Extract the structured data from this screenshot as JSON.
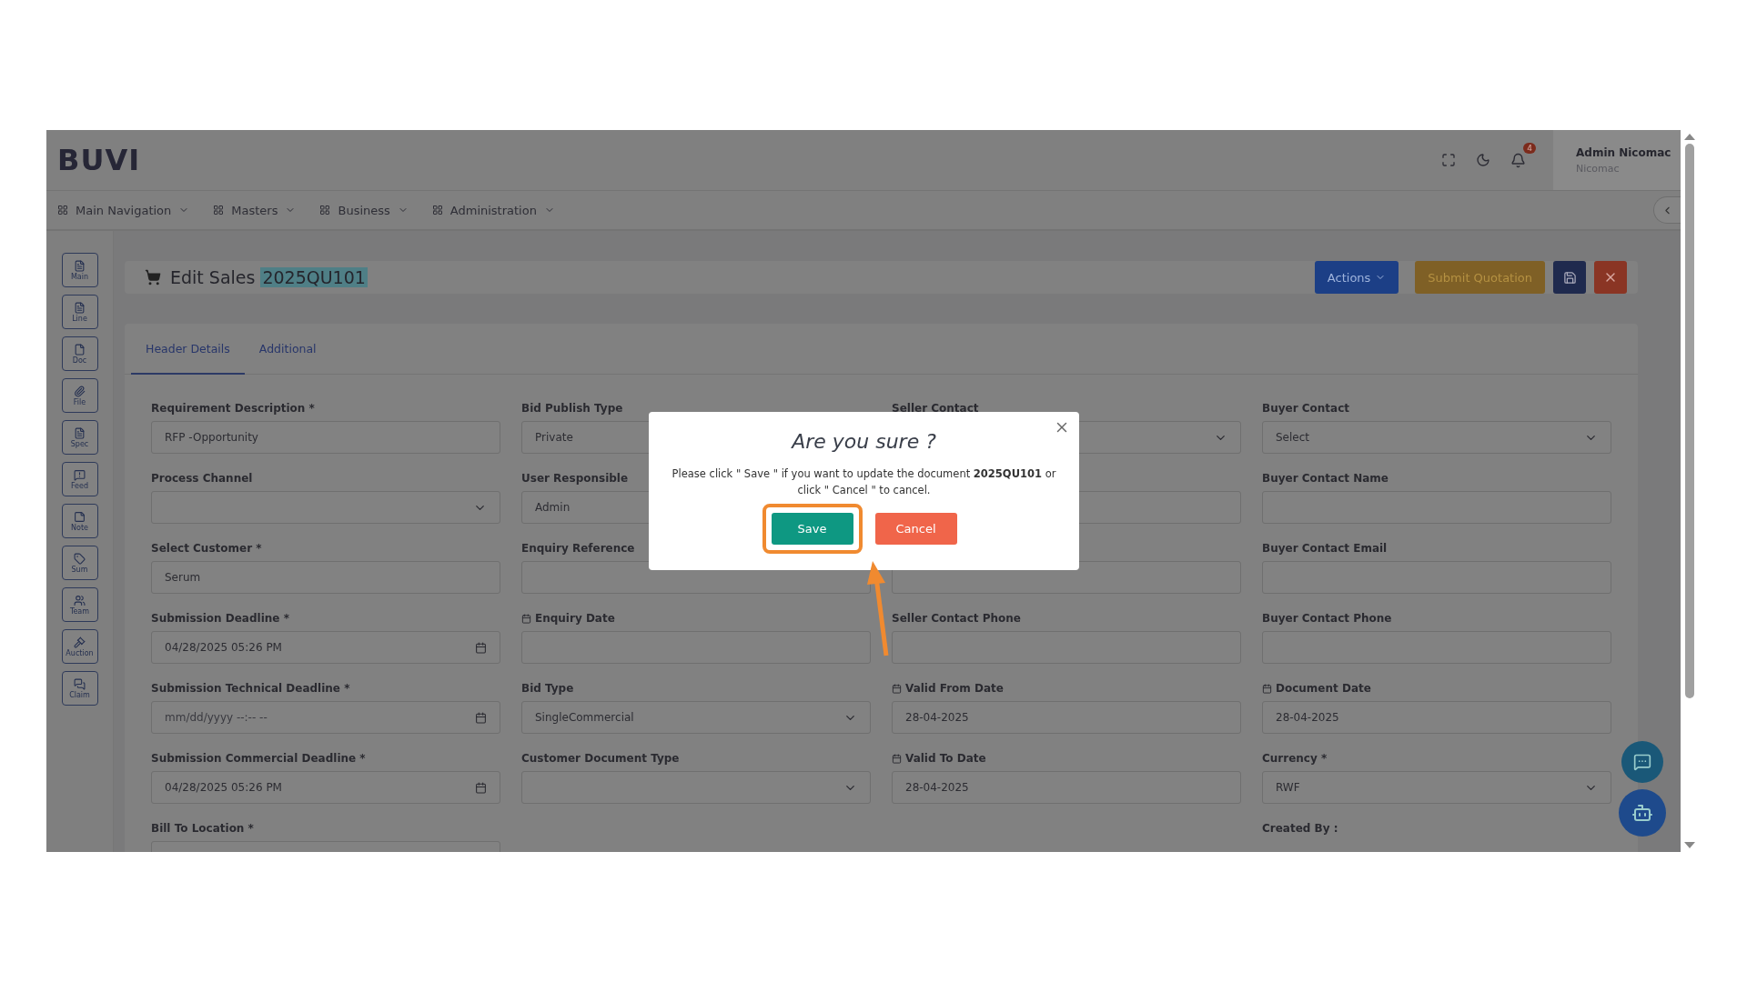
{
  "brand": "BUVI",
  "toolbar": {
    "notification_count": "4",
    "user_name": "Admin Nicomac",
    "user_org": "Nicomac"
  },
  "nav": [
    {
      "label": "Main Navigation"
    },
    {
      "label": "Masters"
    },
    {
      "label": "Business"
    },
    {
      "label": "Administration"
    }
  ],
  "side_tools": [
    {
      "label": "Main",
      "kind": "doc"
    },
    {
      "label": "Line",
      "kind": "doc"
    },
    {
      "label": "Doc",
      "kind": "page"
    },
    {
      "label": "File",
      "kind": "clip"
    },
    {
      "label": "Spec",
      "kind": "doc"
    },
    {
      "label": "Feed",
      "kind": "feedback"
    },
    {
      "label": "Note",
      "kind": "note"
    },
    {
      "label": "Sum",
      "kind": "tag"
    },
    {
      "label": "Team",
      "kind": "team"
    },
    {
      "label": "Auction",
      "kind": "gavel"
    },
    {
      "label": "Claim",
      "kind": "chat"
    }
  ],
  "page": {
    "title": "Edit Sales",
    "doc_no": "2025QU101",
    "doc_no_highlighted": true
  },
  "actions": [
    {
      "kind": "dropdown",
      "label": "Actions"
    },
    {
      "kind": "text",
      "label": "Submit Quotation"
    },
    {
      "kind": "save"
    },
    {
      "kind": "close"
    }
  ],
  "tabs": [
    {
      "label": "Header Details",
      "selected": true
    },
    {
      "label": "Additional",
      "selected": false
    }
  ],
  "columns": [
    [
      {
        "label": "Requirement Description *",
        "kind": "text",
        "value": "RFP -Opportunity"
      },
      {
        "label": "Process Channel",
        "kind": "select"
      },
      {
        "label": "Select Customer *",
        "kind": "text",
        "value": "Serum"
      },
      {
        "label": "Submission Deadline *",
        "kind": "datetime",
        "value": "04/28/2025 05:26 PM"
      },
      {
        "label": "Submission Technical Deadline *",
        "kind": "datetime",
        "placeholder": "mm/dd/yyyy --:-- --"
      },
      {
        "label": "Submission Commercial Deadline *",
        "kind": "datetime",
        "value": "04/28/2025 05:26 PM"
      },
      {
        "label": "Bill To Location *",
        "kind": "text"
      }
    ],
    [
      {
        "label": "Bid Publish Type",
        "kind": "text",
        "value": "Private"
      },
      {
        "label": "User Responsible",
        "kind": "text",
        "value": "Admin"
      },
      {
        "label": "Enquiry Reference",
        "kind": "text"
      },
      {
        "label": "Enquiry Date",
        "kind": "date"
      },
      {
        "label": "Bid Type",
        "kind": "select",
        "value": "SingleCommercial"
      },
      {
        "label": "Customer Document Type",
        "kind": "select"
      }
    ],
    [
      {
        "label": "Seller Contact",
        "kind": "select"
      },
      {
        "kind": "text"
      },
      {
        "kind": "text"
      },
      {
        "label": "Seller Contact Phone",
        "kind": "text"
      },
      {
        "label": "Valid From Date",
        "kind": "date",
        "value": "28-04-2025"
      },
      {
        "label": "Valid To Date",
        "kind": "date",
        "value": "28-04-2025"
      }
    ],
    [
      {
        "label": "Buyer Contact",
        "kind": "select",
        "value": "Select"
      },
      {
        "label": "Buyer Contact Name",
        "kind": "text"
      },
      {
        "label": "Buyer Contact Email",
        "kind": "text"
      },
      {
        "label": "Buyer Contact Phone",
        "kind": "text"
      },
      {
        "label": "Document Date",
        "kind": "date",
        "value": "28-04-2025"
      },
      {
        "label": "Currency *",
        "kind": "select",
        "value": "RWF"
      },
      {
        "label": "Created By :",
        "kind": "info"
      }
    ]
  ],
  "dialog": {
    "title": "Are you sure ?",
    "message": "Please click \" Save \" if you want to update the document **2025QU101** or click \" Cancel \" to cancel.",
    "buttons": [
      {
        "kind": "confirm",
        "label": "Save",
        "highlighted": true
      },
      {
        "kind": "cancel",
        "label": "Cancel",
        "highlighted": false
      }
    ]
  }
}
